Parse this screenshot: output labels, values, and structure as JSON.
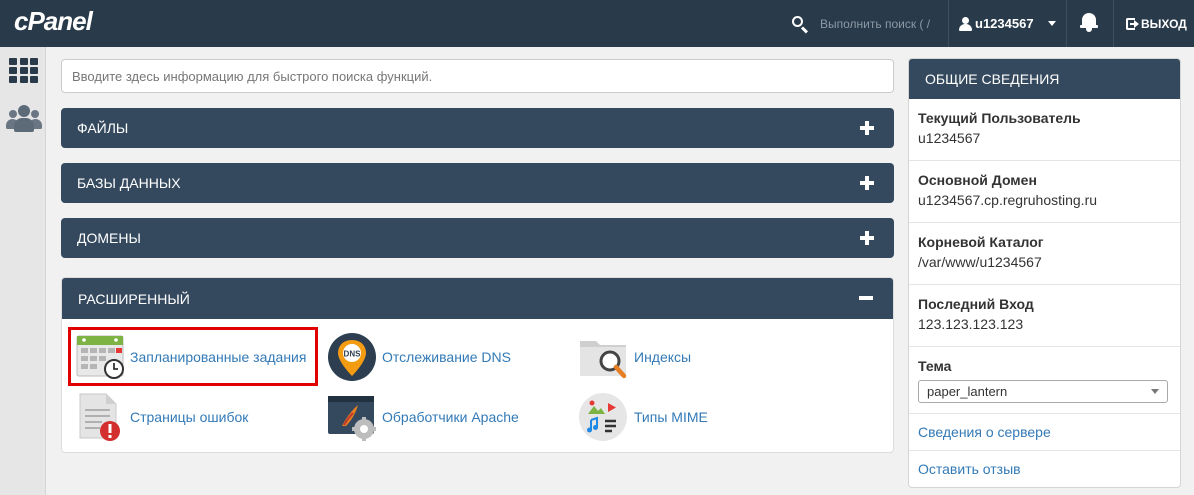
{
  "topbar": {
    "logo": "cPanel",
    "search_label": "Выполнить поиск ( /",
    "username": "u1234567",
    "logout_label": "ВЫХОД"
  },
  "main": {
    "quick_search_placeholder": "Вводите здесь информацию для быстрого поиска функций.",
    "sections": {
      "files": "ФАЙЛЫ",
      "databases": "БАЗЫ ДАННЫХ",
      "domains": "ДОМЕНЫ",
      "advanced": "РАСШИРЕННЫЙ"
    },
    "advanced_tools": [
      {
        "label": "Запланированные задания",
        "icon": "calendar-clock-icon"
      },
      {
        "label": "Отслеживание DNS",
        "icon": "dns-pin-icon"
      },
      {
        "label": "Индексы",
        "icon": "folder-search-icon"
      },
      {
        "label": "Страницы ошибок",
        "icon": "error-page-icon"
      },
      {
        "label": "Обработчики Apache",
        "icon": "apache-handler-icon"
      },
      {
        "label": "Типы MIME",
        "icon": "mime-types-icon"
      }
    ]
  },
  "sidebar": {
    "title": "ОБЩИЕ СВЕДЕНИЯ",
    "current_user_label": "Текущий Пользователь",
    "current_user_value": "u1234567",
    "main_domain_label": "Основной Домен",
    "main_domain_value": "u1234567.cp.regruhosting.ru",
    "home_dir_label": "Корневой Каталог",
    "home_dir_value": "/var/www/u1234567",
    "last_login_label": "Последний Вход",
    "last_login_value": "123.123.123.123",
    "theme_label": "Тема",
    "theme_value": "paper_lantern",
    "server_info_link": "Сведения о сервере",
    "feedback_link": "Оставить отзыв"
  },
  "colors": {
    "topbar": "#293a4a",
    "panel_header": "#34495e",
    "link": "#337ab7",
    "highlight": "#e00000"
  }
}
